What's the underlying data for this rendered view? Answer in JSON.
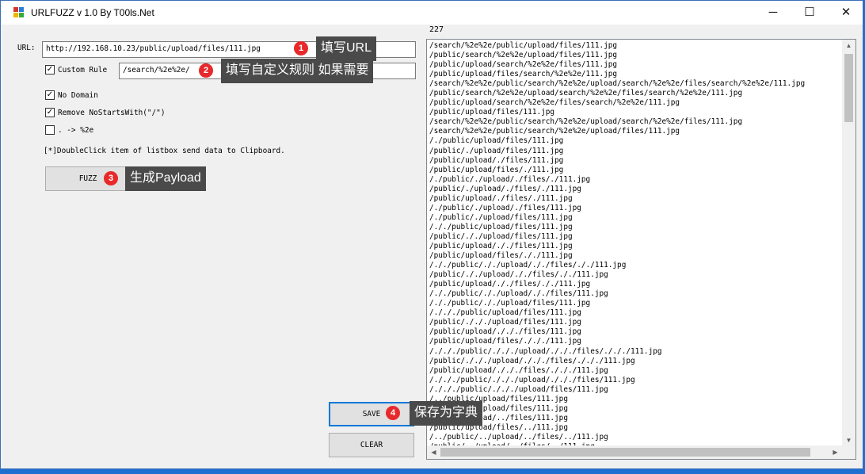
{
  "window": {
    "title": "URLFUZZ v 1.0 By T00ls.Net",
    "minimize": "─",
    "maximize": "☐",
    "close": "✕"
  },
  "form": {
    "url_label": "URL:",
    "url_value": "http://192.168.10.23/public/upload/files/111.jpg",
    "custom_rule_label": "Custom Rule",
    "custom_rule_value": "/search/%2e%2e/",
    "custom_rule_checked": true,
    "no_domain_label": "No Domain",
    "no_domain_checked": true,
    "remove_label": "Remove NoStartsWith(\"/\")",
    "remove_checked": true,
    "dot_label": ". -> %2e",
    "dot_checked": false,
    "hint": "[*]DoubleClick item of listbox send data to Clipboard.",
    "fuzz_label": "FUZZ",
    "save_label": "SAVE",
    "clear_label": "CLEAR",
    "check_mark": "✓"
  },
  "callouts": [
    {
      "num": "1",
      "text": "填写URL"
    },
    {
      "num": "2",
      "text": "填写自定义规则 如果需要"
    },
    {
      "num": "3",
      "text": "生成Payload"
    },
    {
      "num": "4",
      "text": "保存为字典"
    }
  ],
  "results": {
    "count": "227",
    "items": [
      "/search/%2e%2e/public/upload/files/111.jpg",
      "/public/search/%2e%2e/upload/files/111.jpg",
      "/public/upload/search/%2e%2e/files/111.jpg",
      "/public/upload/files/search/%2e%2e/111.jpg",
      "/search/%2e%2e/public/search/%2e%2e/upload/search/%2e%2e/files/search/%2e%2e/111.jpg",
      "/public/search/%2e%2e/upload/search/%2e%2e/files/search/%2e%2e/111.jpg",
      "/public/upload/search/%2e%2e/files/search/%2e%2e/111.jpg",
      "/public/upload/files/111.jpg",
      "/search/%2e%2e/public/search/%2e%2e/upload/search/%2e%2e/files/111.jpg",
      "/search/%2e%2e/public/search/%2e%2e/upload/files/111.jpg",
      "/./public/upload/files/111.jpg",
      "/public/./upload/files/111.jpg",
      "/public/upload/./files/111.jpg",
      "/public/upload/files/./111.jpg",
      "/./public/./upload/./files/./111.jpg",
      "/public/./upload/./files/./111.jpg",
      "/public/upload/./files/./111.jpg",
      "/./public/./upload/./files/111.jpg",
      "/./public/./upload/files/111.jpg",
      "/././public/upload/files/111.jpg",
      "/public/././upload/files/111.jpg",
      "/public/upload/././files/111.jpg",
      "/public/upload/files/././111.jpg",
      "/././public/././upload/././files/././111.jpg",
      "/public/././upload/././files/././111.jpg",
      "/public/upload/././files/././111.jpg",
      "/././public/././upload/././files/111.jpg",
      "/././public/././upload/files/111.jpg",
      "/./././public/upload/files/111.jpg",
      "/public/./././upload/files/111.jpg",
      "/public/upload/./././files/111.jpg",
      "/public/upload/files/./././111.jpg",
      "/./././public/./././upload/./././files/./././111.jpg",
      "/public/./././upload/./././files/./././111.jpg",
      "/public/upload/./././files/./././111.jpg",
      "/./././public/./././upload/./././files/111.jpg",
      "/./././public/./././upload/files/111.jpg",
      "/../public/upload/files/111.jpg",
      "/public/../upload/files/111.jpg",
      "/public/upload/../files/111.jpg",
      "/public/upload/files/../111.jpg",
      "/../public/../upload/../files/../111.jpg",
      "/public/../upload/../files/../111.jpg"
    ]
  }
}
